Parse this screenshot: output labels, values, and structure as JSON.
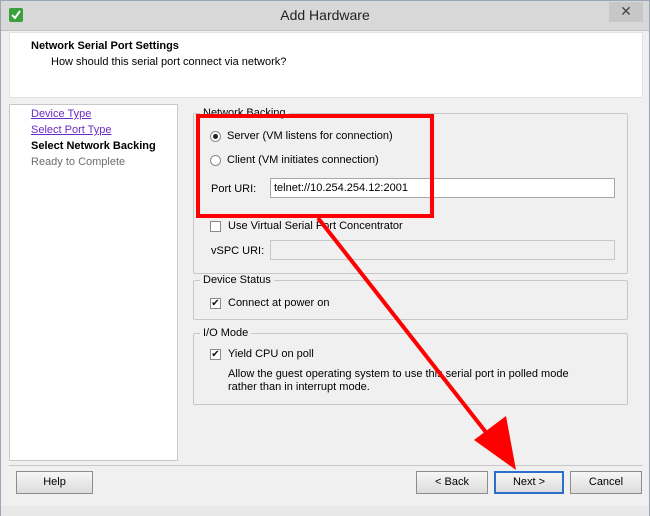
{
  "window": {
    "title": "Add Hardware",
    "close_glyph": "✕",
    "app_icon": "vsphere-app-icon"
  },
  "header": {
    "title": "Network Serial Port Settings",
    "subtitle": "How should this serial port connect via network?"
  },
  "sidebar": {
    "items": [
      {
        "label": "Device Type",
        "state": "link"
      },
      {
        "label": "Select Port Type",
        "state": "link"
      },
      {
        "label": "Select Network Backing",
        "state": "current"
      },
      {
        "label": "Ready to Complete",
        "state": "disabled"
      }
    ]
  },
  "network_backing": {
    "group_label": "Network Backing",
    "server_label": "Server (VM listens for connection)",
    "client_label": "Client   (VM initiates connection)",
    "selected": "server",
    "port_uri_label": "Port URI:",
    "port_uri_value": "telnet://10.254.254.12:2001",
    "vspc_checkbox_label": "Use Virtual Serial Port Concentrator",
    "vspc_checked": false,
    "vspc_uri_label": "vSPC URI:",
    "vspc_uri_value": ""
  },
  "device_status": {
    "group_label": "Device Status",
    "connect_label": "Connect at power on",
    "connect_checked": true
  },
  "io_mode": {
    "group_label": "I/O Mode",
    "yield_label": "Yield CPU on poll",
    "yield_checked": true,
    "description_line1": "Allow the guest operating system to use this serial port in polled mode",
    "description_line2": "rather than in interrupt mode."
  },
  "footer": {
    "help_label": "Help",
    "back_label": "< Back",
    "next_label": "Next >",
    "cancel_label": "Cancel"
  },
  "colors": {
    "annotation": "#ff0000",
    "link": "#6a2cc5",
    "default_button_border": "#2a6fc9"
  },
  "check_glyph": "✔"
}
